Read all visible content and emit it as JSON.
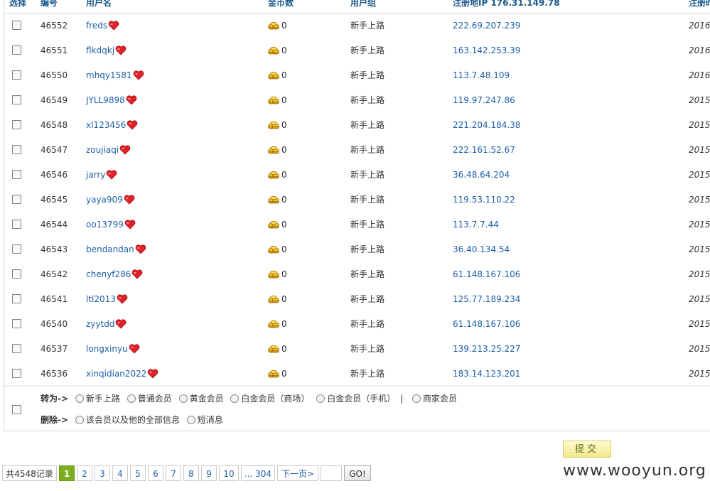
{
  "header": {
    "select": "选择",
    "id": "编号",
    "username": "用户名",
    "gold": "金币数",
    "group": "用户组",
    "reg_ip": "注册地IP 176.31.149.78",
    "reg_date": "注册时"
  },
  "rows": [
    {
      "id": "46552",
      "username": "freds",
      "gold": "0",
      "group": "新手上路",
      "ip": "222.69.207.239",
      "date": "2016-"
    },
    {
      "id": "46551",
      "username": "flkdqkj",
      "gold": "0",
      "group": "新手上路",
      "ip": "163.142.253.39",
      "date": "2016-"
    },
    {
      "id": "46550",
      "username": "mhqy1581",
      "gold": "0",
      "group": "新手上路",
      "ip": "113.7.48.109",
      "date": "2016-"
    },
    {
      "id": "46549",
      "username": "JYLL9898",
      "gold": "0",
      "group": "新手上路",
      "ip": "119.97.247.86",
      "date": "2015-"
    },
    {
      "id": "46548",
      "username": "xl123456",
      "gold": "0",
      "group": "新手上路",
      "ip": "221.204.184.38",
      "date": "2015-"
    },
    {
      "id": "46547",
      "username": "zoujiaqi",
      "gold": "0",
      "group": "新手上路",
      "ip": "222.161.52.67",
      "date": "2015-"
    },
    {
      "id": "46546",
      "username": "jarry",
      "gold": "0",
      "group": "新手上路",
      "ip": "36.48.64.204",
      "date": "2015-"
    },
    {
      "id": "46545",
      "username": "yaya909",
      "gold": "0",
      "group": "新手上路",
      "ip": "119.53.110.22",
      "date": "2015-"
    },
    {
      "id": "46544",
      "username": "oo13799",
      "gold": "0",
      "group": "新手上路",
      "ip": "113.7.7.44",
      "date": "2015-"
    },
    {
      "id": "46543",
      "username": "bendandan",
      "gold": "0",
      "group": "新手上路",
      "ip": "36.40.134.54",
      "date": "2015-"
    },
    {
      "id": "46542",
      "username": "chenyf286",
      "gold": "0",
      "group": "新手上路",
      "ip": "61.148.167.106",
      "date": "2015-"
    },
    {
      "id": "46541",
      "username": "ltl2013",
      "gold": "0",
      "group": "新手上路",
      "ip": "125.77.189.234",
      "date": "2015-"
    },
    {
      "id": "46540",
      "username": "zyytdd",
      "gold": "0",
      "group": "新手上路",
      "ip": "61.148.167.106",
      "date": "2015-"
    },
    {
      "id": "46537",
      "username": "longxinyu",
      "gold": "0",
      "group": "新手上路",
      "ip": "139.213.25.227",
      "date": "2015-"
    },
    {
      "id": "46536",
      "username": "xinqidian2022",
      "gold": "0",
      "group": "新手上路",
      "ip": "183.14.123.201",
      "date": "2015-"
    }
  ],
  "actions": {
    "move_label": "转为->",
    "move_options": [
      "新手上路",
      "普通会员",
      "黄金会员",
      "白金会员（商场）",
      "白金会员（手机）",
      "商家会员"
    ],
    "separator": "|",
    "delete_label": "删除->",
    "delete_options": [
      "该会员以及他的全部信息",
      "短消息"
    ]
  },
  "submit_label": "提交",
  "pager": {
    "total": "共4548记录",
    "pages": [
      "1",
      "2",
      "3",
      "4",
      "5",
      "6",
      "7",
      "8",
      "9",
      "10"
    ],
    "current": "1",
    "last": "... 304",
    "next": "下一页>",
    "go": "GO!"
  },
  "watermark": "www.wooyun.org",
  "colors": {
    "link": "#1d5fa8",
    "current_page": "#7dae1d",
    "submit_bg": "#f6ee9e"
  },
  "icons": {
    "status": "heart-icon",
    "gold": "coins-icon"
  }
}
